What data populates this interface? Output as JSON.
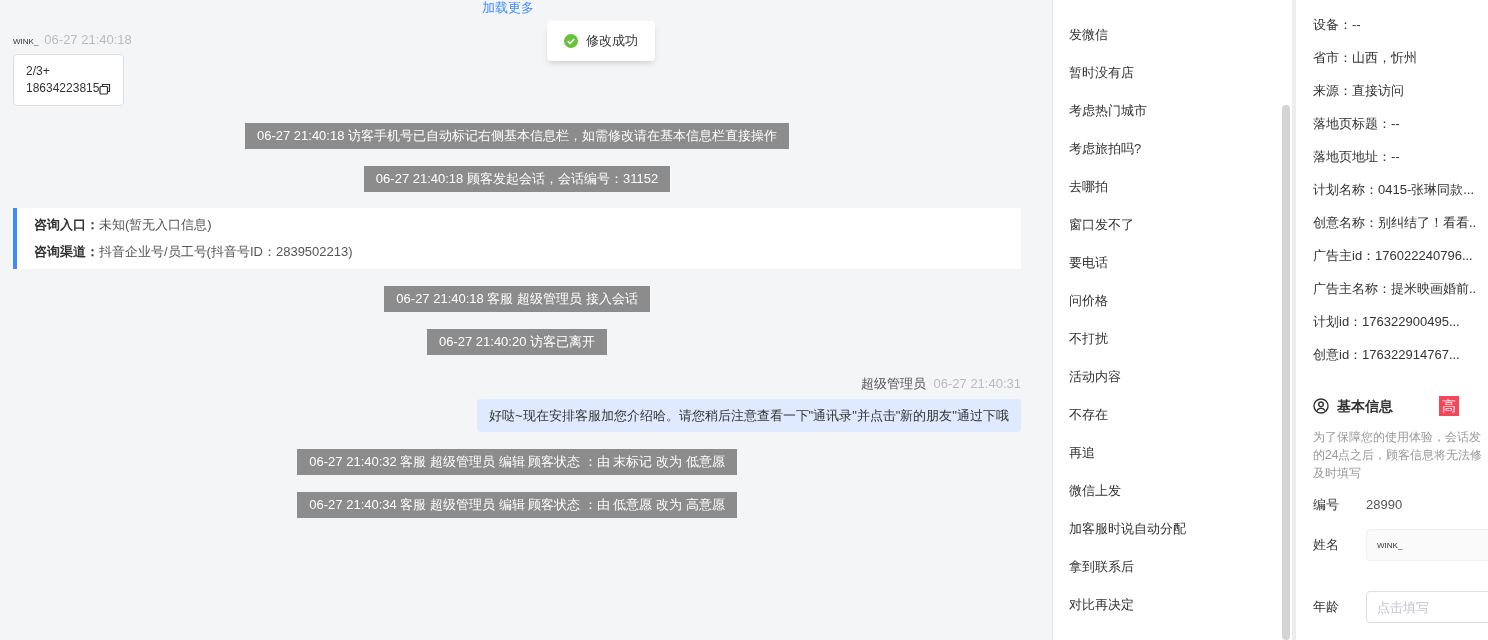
{
  "chat": {
    "load_more": "加载更多",
    "messages": [
      {
        "kind": "visitor",
        "sender": "WINK_",
        "time": "06-27 21:40:18",
        "lines": [
          "2/3+",
          "18634223815"
        ]
      },
      {
        "kind": "system",
        "text": "06-27 21:40:18 访客手机号已自动标记右侧基本信息栏，如需修改请在基本信息栏直接操作"
      },
      {
        "kind": "system",
        "text": "06-27 21:40:18 顾客发起会话，会话编号：31152"
      },
      {
        "kind": "info",
        "rows": [
          {
            "label": "咨询入口：",
            "value": "未知(暂无入口信息)"
          },
          {
            "label": "咨询渠道：",
            "value": "抖音企业号/员工号(抖音号ID：2839502213)"
          }
        ]
      },
      {
        "kind": "system",
        "text": "06-27 21:40:18 客服 超级管理员 接入会话"
      },
      {
        "kind": "system",
        "text": "06-27 21:40:20 访客已离开"
      },
      {
        "kind": "agent",
        "sender": "超级管理员",
        "time": "06-27 21:40:31",
        "text": "好哒~现在安排客服加您介绍哈。请您稍后注意查看一下\"通讯录\"并点击\"新的朋友\"通过下哦"
      },
      {
        "kind": "system",
        "text": "06-27 21:40:32 客服 超级管理员 编辑 顾客状态 ：由 末标记 改为 低意愿"
      },
      {
        "kind": "system",
        "text": "06-27 21:40:34 客服 超级管理员 编辑 顾客状态 ：由 低意愿 改为 高意愿"
      }
    ]
  },
  "toast": {
    "text": "修改成功"
  },
  "quick_replies": [
    "发微信",
    "暂时没有店",
    "考虑热门城市",
    "考虑旅拍吗?",
    "去哪拍",
    "窗口发不了",
    "要电话",
    "问价格",
    "不打扰",
    "活动内容",
    "不存在",
    "再追",
    "微信上发",
    "加客服时说自动分配",
    "拿到联系后",
    "对比再决定"
  ],
  "visitor_details": [
    "设备：--",
    "省市：山西，忻州",
    "来源：直接访问",
    "落地页标题：--",
    "落地页地址：--",
    "计划名称：0415-张琳同款...",
    "创意名称：别纠结了！看看..",
    "广告主id：176022240796...",
    "广告主名称：提米映画婚前..",
    "计划id：176322900495...",
    "创意id：176322914767..."
  ],
  "basic_info": {
    "title": "基本信息",
    "badge": "高",
    "notice": [
      "为了保障您的使用体验，会话发",
      "的24点之后，顾客信息将无法修",
      "及时填写"
    ],
    "fields": [
      {
        "kind": "text",
        "label": "编号",
        "value": "28990"
      },
      {
        "kind": "input",
        "label": "姓名",
        "value": "WINK_"
      },
      {
        "kind": "input",
        "label": "年龄",
        "placeholder": "点击填写"
      }
    ]
  }
}
